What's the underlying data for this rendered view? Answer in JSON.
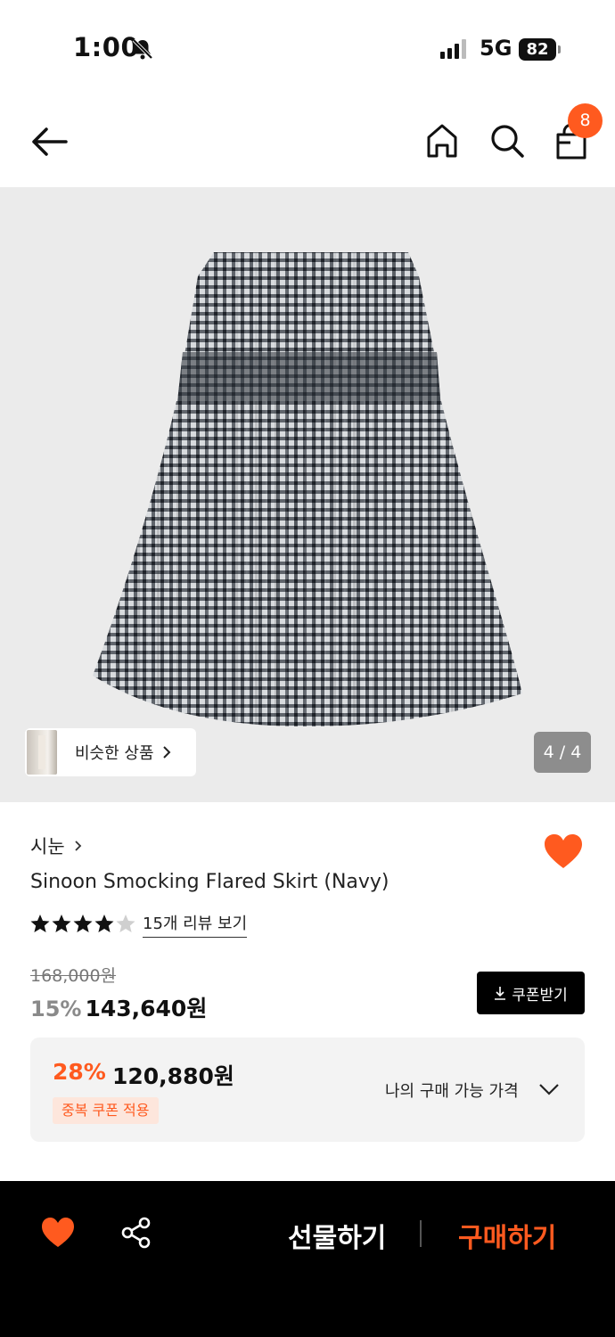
{
  "status_bar": {
    "time": "1:00",
    "network": "5G",
    "battery": "82"
  },
  "nav": {
    "cart_count": "8"
  },
  "gallery": {
    "similar_label": "비슷한 상품",
    "counter": "4 / 4"
  },
  "product": {
    "brand": "시눈",
    "title": "Sinoon Smocking Flared Skirt (Navy)",
    "rating": 4.5,
    "reviews_label": "15개 리뷰 보기",
    "original_price": "168,000원",
    "discount": "15%",
    "price": "143,640원",
    "coupon_button": "쿠폰받기"
  },
  "my_price": {
    "discount": "28%",
    "price": "120,880원",
    "tag": "중복 쿠폰 적용",
    "label": "나의 구매 가능 가격"
  },
  "bottom_bar": {
    "gift_label": "선물하기",
    "buy_label": "구매하기"
  },
  "colors": {
    "accent": "#ff5a1f",
    "bar": "#000000",
    "gallery_bg": "#ebebeb"
  }
}
